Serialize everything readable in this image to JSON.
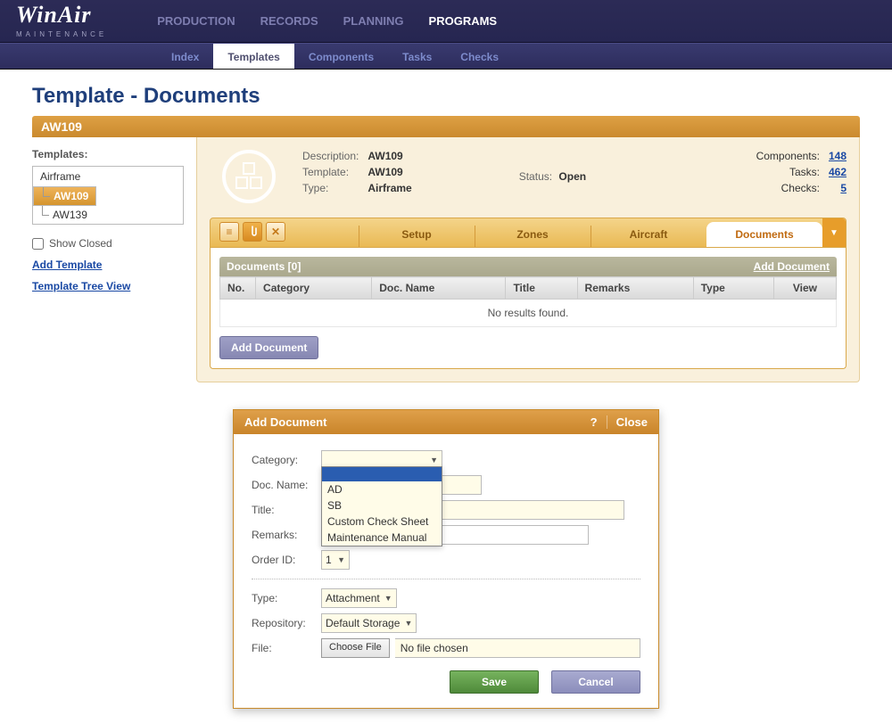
{
  "logo": {
    "main": "WinAir",
    "sub": "MAINTENANCE"
  },
  "topnav": {
    "production": "PRODUCTION",
    "records": "RECORDS",
    "planning": "PLANNING",
    "programs": "PROGRAMS"
  },
  "subnav": {
    "index": "Index",
    "templates": "Templates",
    "components": "Components",
    "tasks": "Tasks",
    "checks": "Checks"
  },
  "page_title": "Template - Documents",
  "band": "AW109",
  "sidebar": {
    "label": "Templates:",
    "root": "Airframe",
    "items": [
      "AW109",
      "AW139"
    ],
    "show_closed": "Show Closed",
    "add_template": "Add Template",
    "tree_view": "Template Tree View"
  },
  "info": {
    "desc_k": "Description:",
    "desc_v": "AW109",
    "tmpl_k": "Template:",
    "tmpl_v": "AW109",
    "type_k": "Type:",
    "type_v": "Airframe",
    "status_k": "Status:",
    "status_v": "Open"
  },
  "counts": {
    "components_k": "Components:",
    "components_v": "148",
    "tasks_k": "Tasks:",
    "tasks_v": "462",
    "checks_k": "Checks:",
    "checks_v": "5"
  },
  "tabs": {
    "setup": "Setup",
    "zones": "Zones",
    "aircraft": "Aircraft",
    "documents": "Documents"
  },
  "docs": {
    "header": "Documents [0]",
    "add_link": "Add Document",
    "cols": {
      "no": "No.",
      "category": "Category",
      "docname": "Doc. Name",
      "title": "Title",
      "remarks": "Remarks",
      "type": "Type",
      "view": "View"
    },
    "empty": "No results found.",
    "add_btn": "Add Document"
  },
  "dialog": {
    "title": "Add Document",
    "help": "?",
    "close": "Close",
    "category_k": "Category:",
    "docname_k": "Doc. Name:",
    "title_k": "Title:",
    "remarks_k": "Remarks:",
    "orderid_k": "Order ID:",
    "orderid_v": "1",
    "type_k": "Type:",
    "type_v": "Attachment",
    "repo_k": "Repository:",
    "repo_v": "Default Storage",
    "file_k": "File:",
    "choose": "Choose File",
    "nofile": "No file chosen",
    "save": "Save",
    "cancel": "Cancel",
    "category_options": [
      "",
      "AD",
      "SB",
      "Custom Check Sheet",
      "Maintenance Manual"
    ]
  }
}
